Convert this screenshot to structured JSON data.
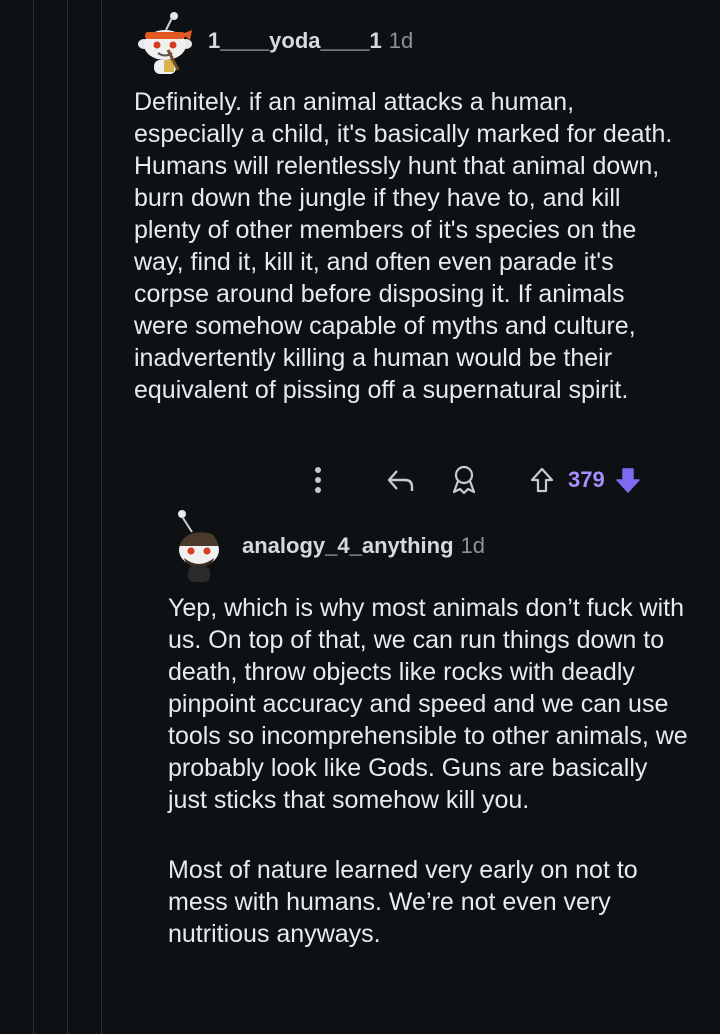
{
  "comments": [
    {
      "author": "1____yoda____1",
      "age": "1d",
      "avatar": "snoo-avatar-headband-icon",
      "body": "Definitely. if an animal attacks a human, especially a child, it's basically marked for death. Humans will relentlessly hunt that animal down, burn down the jungle if they have to, and kill plenty of other members of it's species on the way, find it, kill it, and often even parade it's corpse around before disposing it. If animals were somehow capable of myths and culture, inadvertently killing a human would be their equivalent of pissing off a supernatural spirit.",
      "score": "379",
      "icons": {
        "more": "more-vertical-icon",
        "reply": "reply-icon",
        "award": "award-icon",
        "upvote": "upvote-icon",
        "downvote": "downvote-icon"
      }
    },
    {
      "author": "analogy_4_anything",
      "age": "1d",
      "avatar": "snoo-avatar-beard-icon",
      "paragraphs": [
        "Yep, which is why most animals don’t fuck with us. On top of that, we can run things down to death, throw objects like rocks with deadly pinpoint accuracy and speed and we can use tools so incomprehensible to other animals, we probably look like Gods. Guns are basically just sticks that somehow kill you.",
        "Most of nature learned very early on not to mess with humans. We’re not even very nutritious anyways."
      ]
    }
  ],
  "colors": {
    "background": "#0e1113",
    "text": "#e8eaec",
    "meta": "#8c9297",
    "upvoted": "#a98cff",
    "downvote_active": "#7e6af0",
    "thread_line": "#2b3236"
  }
}
